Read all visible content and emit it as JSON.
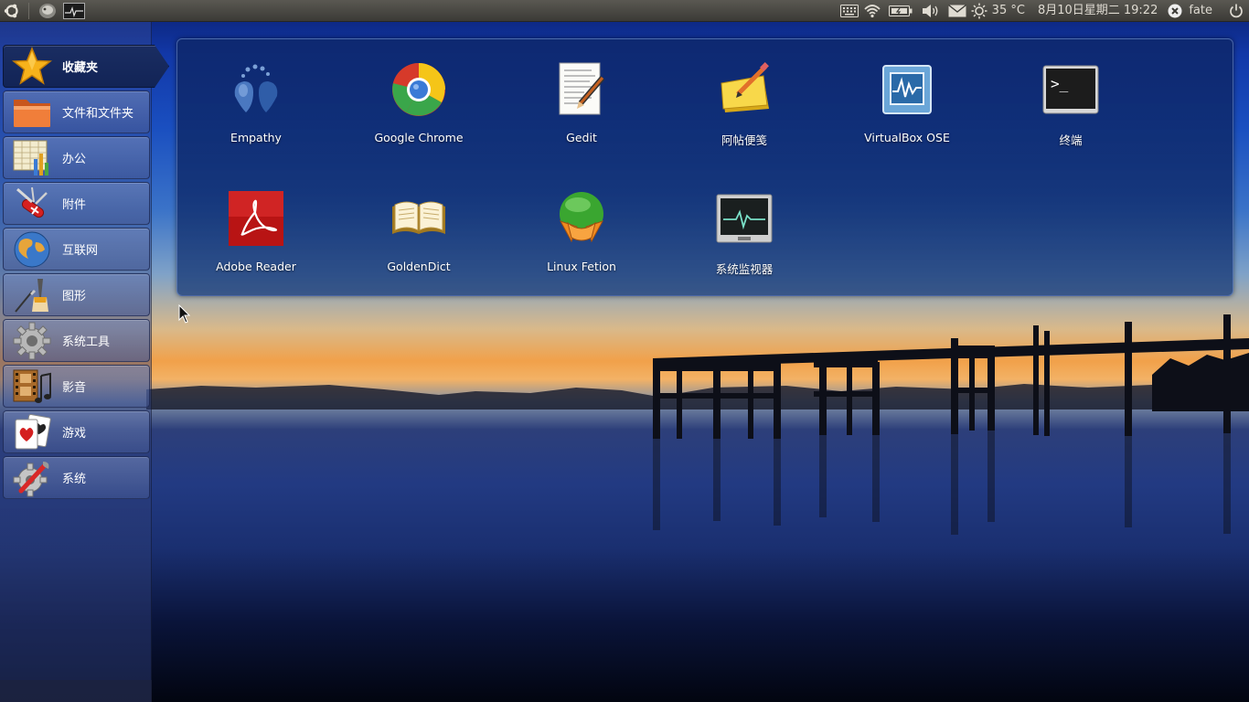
{
  "top_panel": {
    "left_icons": [
      "ubuntu-logo-icon",
      "gwibber-icon",
      "system-monitor-icon"
    ],
    "right": {
      "temperature": "35 °C",
      "datetime": "8月10日星期二 19:22",
      "user": "fate"
    }
  },
  "launcher": {
    "categories": [
      {
        "label": "收藏夹",
        "icon": "star-icon",
        "active": true
      },
      {
        "label": "文件和文件夹",
        "icon": "folder-icon"
      },
      {
        "label": "办公",
        "icon": "office-icon"
      },
      {
        "label": "附件",
        "icon": "swiss-knife-icon"
      },
      {
        "label": "互联网",
        "icon": "globe-icon"
      },
      {
        "label": "图形",
        "icon": "graphics-brush-icon"
      },
      {
        "label": "系统工具",
        "icon": "gear-icon"
      },
      {
        "label": "影音",
        "icon": "film-music-icon"
      },
      {
        "label": "游戏",
        "icon": "cards-icon"
      },
      {
        "label": "系统",
        "icon": "system-tools-icon"
      }
    ]
  },
  "apps": [
    {
      "label": "Empathy",
      "icon": "empathy-icon"
    },
    {
      "label": "Google Chrome",
      "icon": "chrome-icon"
    },
    {
      "label": "Gedit",
      "icon": "gedit-icon"
    },
    {
      "label": "阿帖便笺",
      "icon": "notes-icon"
    },
    {
      "label": "VirtualBox OSE",
      "icon": "virtualbox-icon"
    },
    {
      "label": "终端",
      "icon": "terminal-icon"
    },
    {
      "label": "Adobe Reader",
      "icon": "adobe-reader-icon"
    },
    {
      "label": "GoldenDict",
      "icon": "goldendict-icon"
    },
    {
      "label": "Linux Fetion",
      "icon": "fetion-icon"
    },
    {
      "label": "系统监视器",
      "icon": "system-monitor-icon"
    }
  ],
  "colors": {
    "panel_bg": "#3b3a36",
    "apps_panel_bg": "#0e286e",
    "active_category": "#1a2d62"
  }
}
